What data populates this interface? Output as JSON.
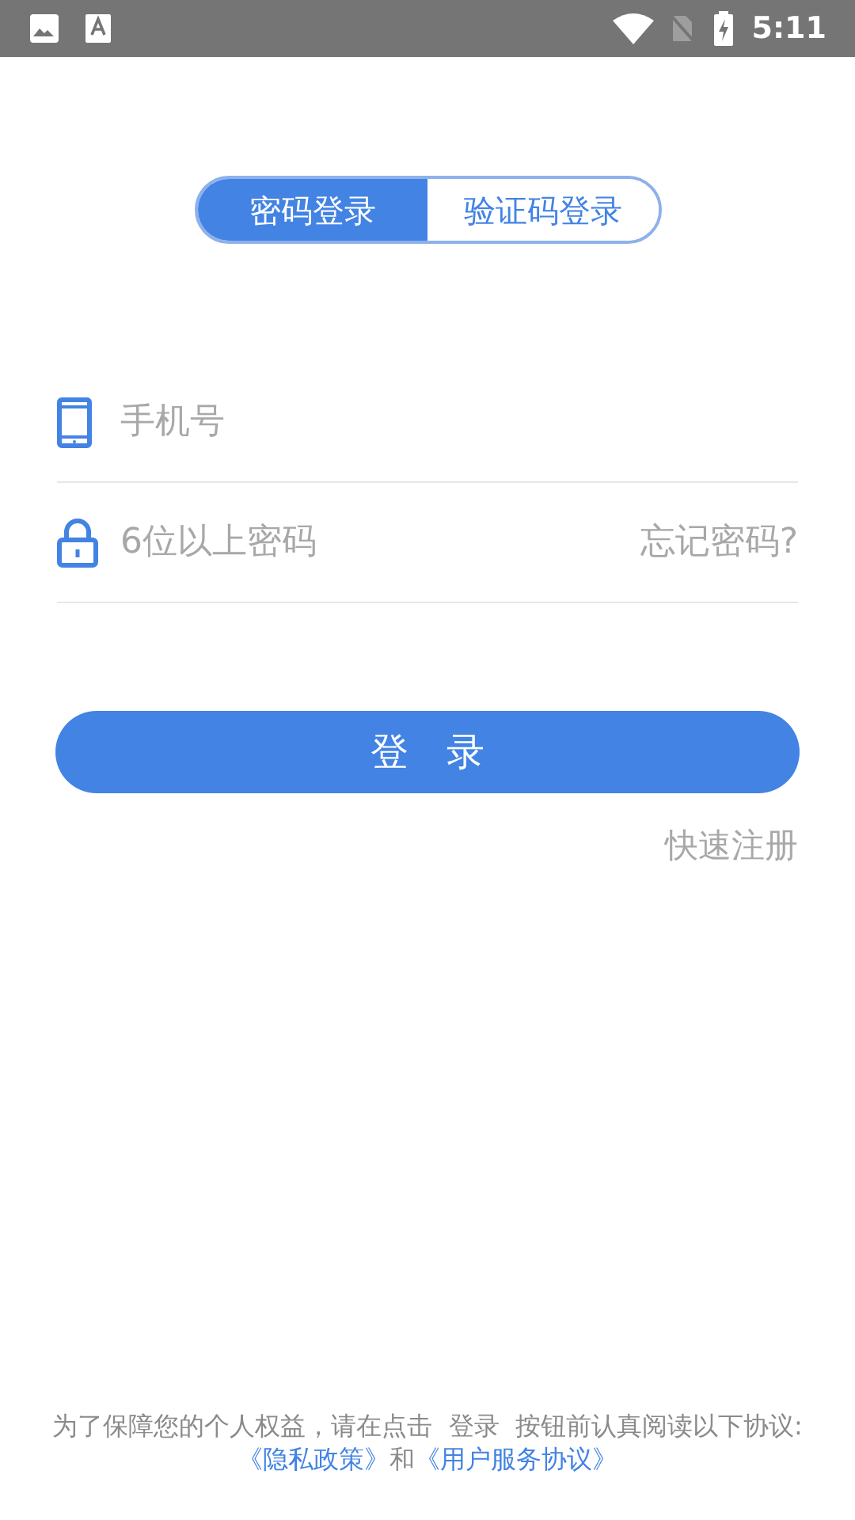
{
  "status_bar": {
    "time": "5:11"
  },
  "tabs": [
    {
      "label": "密码登录",
      "selected": true
    },
    {
      "label": "验证码登录",
      "selected": false
    }
  ],
  "phone_field": {
    "placeholder": "手机号"
  },
  "password_field": {
    "placeholder": "6位以上密码"
  },
  "forgot_link": "忘记密码?",
  "login_button": "登　录",
  "register_link": "快速注册",
  "consent": {
    "text": "为了保障您的个人权益，请在点击  登录  按钮前认真阅读以下协议:",
    "privacy_link": "《隐私政策》",
    "joiner": "和",
    "terms_link": "《用户服务协议》"
  }
}
